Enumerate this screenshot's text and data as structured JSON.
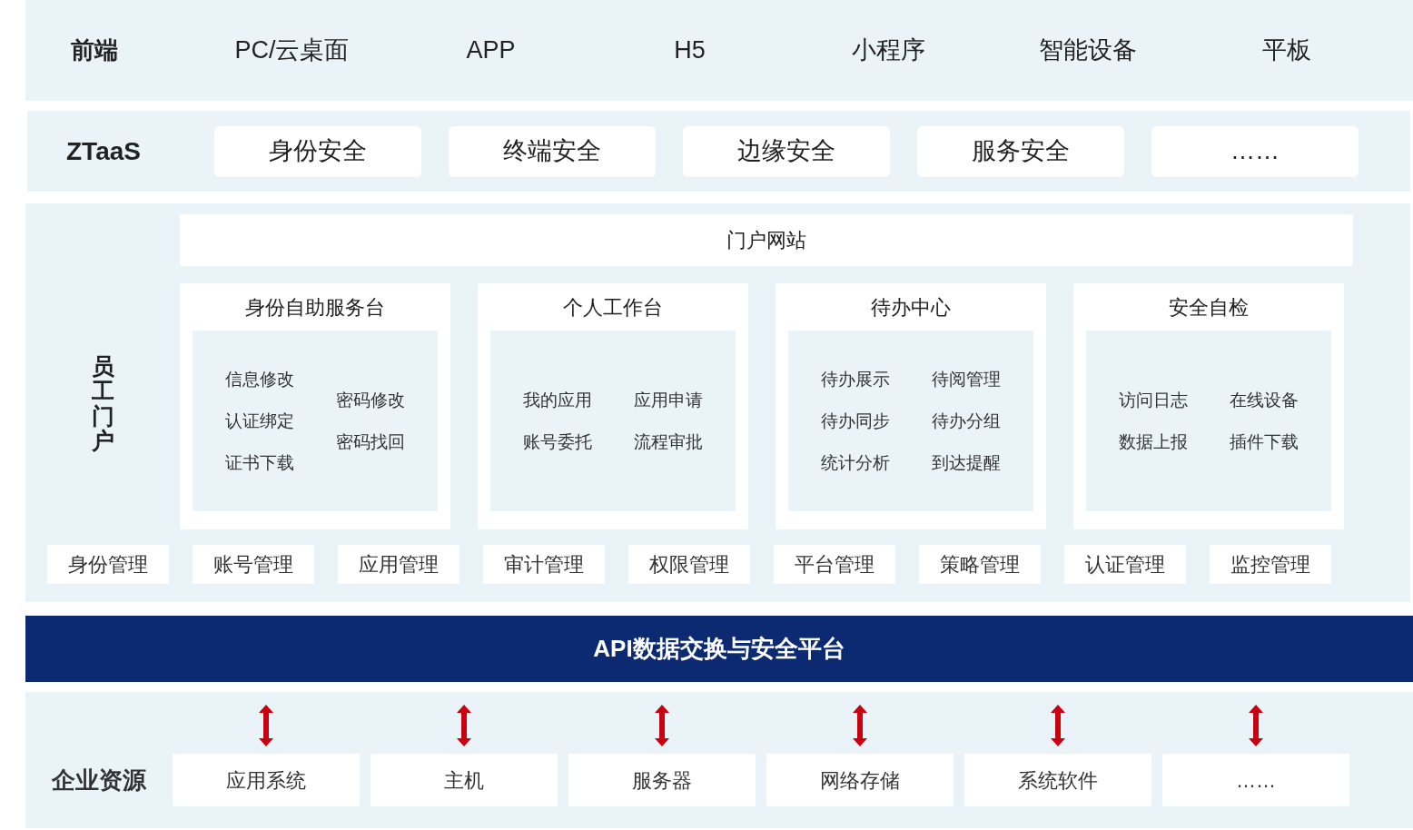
{
  "frontend": {
    "label": "前端",
    "items": [
      "PC/云桌面",
      "APP",
      "H5",
      "小程序",
      "智能设备",
      "平板"
    ]
  },
  "ztaas": {
    "label": "ZTaaS",
    "items": [
      "身份安全",
      "终端安全",
      "边缘安全",
      "服务安全",
      "……"
    ]
  },
  "employee_portal": {
    "label": "员工门户",
    "portal_site": "门户网站",
    "cards": [
      {
        "title": "身份自助服务台",
        "columns": [
          [
            "信息修改",
            "认证绑定",
            "证书下载"
          ],
          [
            "密码修改",
            "密码找回"
          ]
        ]
      },
      {
        "title": "个人工作台",
        "columns": [
          [
            "我的应用",
            "账号委托"
          ],
          [
            "应用申请",
            "流程审批"
          ]
        ]
      },
      {
        "title": "待办中心",
        "columns": [
          [
            "待办展示",
            "待办同步",
            "统计分析"
          ],
          [
            "待阅管理",
            "待办分组",
            "到达提醒"
          ]
        ]
      },
      {
        "title": "安全自检",
        "columns": [
          [
            "访问日志",
            "数据上报"
          ],
          [
            "在线设备",
            "插件下载"
          ]
        ]
      }
    ],
    "management": [
      "身份管理",
      "账号管理",
      "应用管理",
      "审计管理",
      "权限管理",
      "平台管理",
      "策略管理",
      "认证管理",
      "监控管理"
    ]
  },
  "api_platform": "API数据交换与安全平台",
  "enterprise_resources": {
    "label": "企业资源",
    "items": [
      "应用系统",
      "主机",
      "服务器",
      "网络存储",
      "系统软件",
      "……"
    ]
  }
}
